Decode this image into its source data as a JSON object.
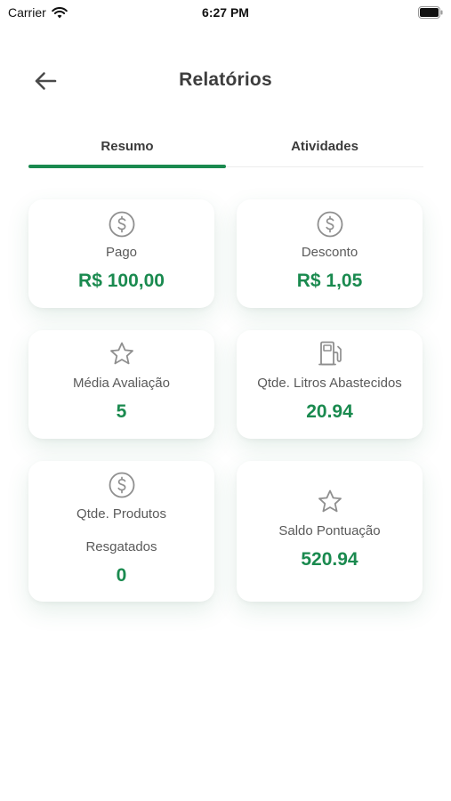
{
  "status_bar": {
    "carrier": "Carrier",
    "time": "6:27 PM"
  },
  "header": {
    "back_icon": "arrow-left-icon",
    "title": "Relatórios"
  },
  "tabs": [
    {
      "label": "Resumo",
      "active": true
    },
    {
      "label": "Atividades",
      "active": false
    }
  ],
  "cards": [
    {
      "icon": "dollar-circle-icon",
      "label": "Pago",
      "value": "R$ 100,00"
    },
    {
      "icon": "dollar-circle-icon",
      "label": "Desconto",
      "value": "R$ 1,05"
    },
    {
      "icon": "star-icon",
      "label": "Média Avaliação",
      "value": "5"
    },
    {
      "icon": "fuel-pump-icon",
      "label": "Qtde. Litros Abastecidos",
      "value": "20.94"
    },
    {
      "icon": "dollar-circle-icon",
      "label_line1": "Qtde. Produtos",
      "label_line2": "Resgatados",
      "value": "0"
    },
    {
      "icon": "star-icon",
      "label": "Saldo Pontuação",
      "value": "520.94"
    }
  ],
  "colors": {
    "accent": "#1a8a4f",
    "icon": "#8f8f8f",
    "text": "#3d3d3d"
  }
}
